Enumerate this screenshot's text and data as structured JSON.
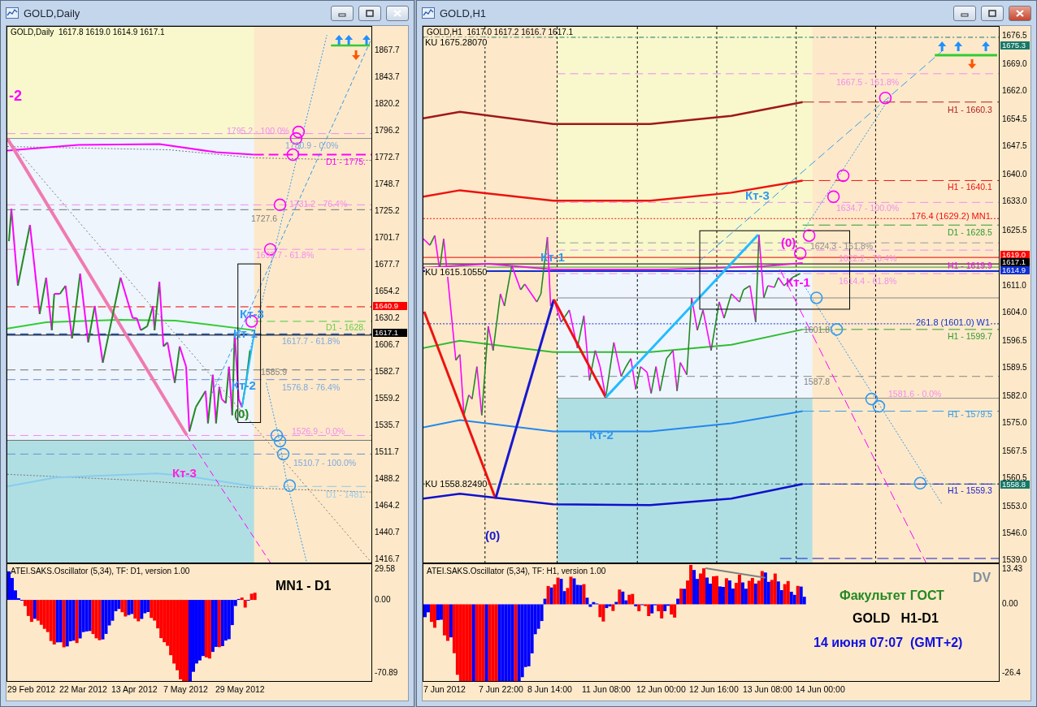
{
  "windows": [
    {
      "title": "GOLD,Daily",
      "active": false,
      "chart": {
        "header": "GOLD,Daily  1617.8 1619.0 1614.9 1617.1",
        "price_ticks": [
          "1867.7",
          "1843.7",
          "1820.2",
          "1796.2",
          "1772.7",
          "1748.7",
          "1725.2",
          "1701.7",
          "1677.7",
          "1654.2",
          "1630.2",
          "1606.7",
          "1582.7",
          "1559.2",
          "1535.7",
          "1511.7",
          "1488.2",
          "1464.2",
          "1440.7",
          "1416.7"
        ],
        "price_tags": [
          {
            "text": "1640.9",
            "color": "#ff0000"
          },
          {
            "text": "1617.1",
            "color": "#000000"
          }
        ],
        "labels": [
          {
            "text": "-2",
            "kind": "wave",
            "color": "#ff00ff"
          },
          {
            "text": "1795.2 - 100.0%",
            "kind": "level",
            "color": "#f08cf0"
          },
          {
            "text": "1780.9 - 0.0%",
            "kind": "level",
            "color": "#7fa8e0"
          },
          {
            "text": "D1 - 1775.",
            "kind": "level",
            "color": "#ff00ff"
          },
          {
            "text": "1731.2 - 76.4%",
            "kind": "level",
            "color": "#f08cf0"
          },
          {
            "text": "1727.6",
            "kind": "level",
            "color": "#808080"
          },
          {
            "text": "1692.7 - 61.8%",
            "kind": "level",
            "color": "#f08cf0"
          },
          {
            "text": "Кт-3",
            "kind": "wave",
            "color": "#3399ee"
          },
          {
            "text": "Кт-1",
            "kind": "wave",
            "color": "#3399ee"
          },
          {
            "text": "D1 - 1628.",
            "kind": "level",
            "color": "#66cc44"
          },
          {
            "text": "1617.7 - 61.8%",
            "kind": "level",
            "color": "#7fa8e0"
          },
          {
            "text": "1585.9",
            "kind": "level",
            "color": "#808080"
          },
          {
            "text": "Кт-2",
            "kind": "wave",
            "color": "#3399ee"
          },
          {
            "text": "1576.8 - 76.4%",
            "kind": "level",
            "color": "#7fa8e0"
          },
          {
            "text": "(0)",
            "kind": "wave",
            "color": "#228822"
          },
          {
            "text": "1526.9 - 0.0%",
            "kind": "level",
            "color": "#f08cf0"
          },
          {
            "text": "1510.7 - 100.0%",
            "kind": "level",
            "color": "#7fa8e0"
          },
          {
            "text": "Кт-3",
            "kind": "wave",
            "color": "#ff22dd"
          },
          {
            "text": "D1 - 1481.",
            "kind": "level",
            "color": "#99ccee"
          }
        ]
      },
      "oscillator": {
        "title": "ATEI.SAKS.Oscillator (5,34), TF: D1, version 1.00",
        "ticks": [
          "29.58",
          "0.00",
          "-70.89"
        ],
        "notes": [
          {
            "text": "MN1 - D1",
            "color": "#000000"
          }
        ]
      },
      "time_axis": [
        "29 Feb 2012",
        "22 Mar 2012",
        "13 Apr 2012",
        "7 May 2012",
        "29 May 2012"
      ]
    },
    {
      "title": "GOLD,H1",
      "active": true,
      "chart": {
        "header": "GOLD,H1  1617.0 1617.2 1616.7 1617.1",
        "price_ticks": [
          "1676.5",
          "1669.0",
          "1662.0",
          "1654.5",
          "1647.5",
          "1640.0",
          "1633.0",
          "1625.5",
          "1611.0",
          "1604.0",
          "1596.5",
          "1589.5",
          "1582.0",
          "1575.0",
          "1567.5",
          "1560.5",
          "1553.0",
          "1546.0",
          "1539.0"
        ],
        "price_tags": [
          {
            "text": "1675.3",
            "color": "#187868"
          },
          {
            "text": "1619.0",
            "color": "#ff0000"
          },
          {
            "text": "1617.1",
            "color": "#000000"
          },
          {
            "text": "1614.9",
            "color": "#1030d0"
          },
          {
            "text": "1558.8",
            "color": "#187868"
          }
        ],
        "labels": [
          {
            "text": "KU 1675.28070",
            "kind": "note",
            "color": "#000000"
          },
          {
            "text": "1667.5 - 161.8%",
            "kind": "level",
            "color": "#f08cf0"
          },
          {
            "text": "H1 - 1660.3",
            "kind": "level",
            "color": "#b02020"
          },
          {
            "text": "H1 - 1640.1",
            "kind": "level",
            "color": "#ee1111"
          },
          {
            "text": "Кт-3",
            "kind": "wave",
            "color": "#3399ee"
          },
          {
            "text": "1634.7 - 100.0%",
            "kind": "level",
            "color": "#f08cf0"
          },
          {
            "text": "176.4 (1629.2) MN1",
            "kind": "note",
            "color": "#ee1111"
          },
          {
            "text": "D1 - 1628.5",
            "kind": "level",
            "color": "#339933"
          },
          {
            "text": "(0)",
            "kind": "wave",
            "color": "#ff00ff"
          },
          {
            "text": "1624.3 - 161.8%",
            "kind": "level",
            "color": "#909090"
          },
          {
            "text": "1622.2 - 76.4%",
            "kind": "level",
            "color": "#f08cf0"
          },
          {
            "text": "H1 - 1619.9",
            "kind": "level",
            "color": "#ff00ff"
          },
          {
            "text": "Кт-1",
            "kind": "wave",
            "color": "#3399ee"
          },
          {
            "text": "KU 1615.10550",
            "kind": "note",
            "color": "#000000"
          },
          {
            "text": "Кт-1",
            "kind": "wave",
            "color": "#ff00ff"
          },
          {
            "text": "1614.4 - 61.8%",
            "kind": "level",
            "color": "#f08cf0"
          },
          {
            "text": "261.8 (1601.0) W1",
            "kind": "note",
            "color": "#1030d0"
          },
          {
            "text": "1601.8",
            "kind": "level",
            "color": "#808080"
          },
          {
            "text": "H1 - 1599.7",
            "kind": "level",
            "color": "#339933"
          },
          {
            "text": "1587.8",
            "kind": "level",
            "color": "#808080"
          },
          {
            "text": "1581.6 - 0.0%",
            "kind": "level",
            "color": "#f08cf0"
          },
          {
            "text": "H1 - 1579.5",
            "kind": "level",
            "color": "#3399ee"
          },
          {
            "text": "Кт-2",
            "kind": "wave",
            "color": "#3399ee"
          },
          {
            "text": "KU 1558.82490",
            "kind": "note",
            "color": "#000000"
          },
          {
            "text": "H1 - 1559.3",
            "kind": "level",
            "color": "#1818d0"
          },
          {
            "text": "(0)",
            "kind": "wave",
            "color": "#1818d0"
          }
        ]
      },
      "oscillator": {
        "title": "ATEI.SAKS.Oscillator (5,34), TF: H1, version 1.00",
        "ticks": [
          "13.43",
          "0.00",
          "-26.4"
        ],
        "notes": [
          {
            "text": "DV",
            "color": "#8090a0"
          },
          {
            "text": "Факультет ГОСТ",
            "color": "#228822"
          },
          {
            "text": "GOLD   H1-D1",
            "color": "#000000"
          },
          {
            "text": "14 июня 07:07  (GMT+2)",
            "color": "#1010e0"
          }
        ]
      },
      "time_axis": [
        "7 Jun 2012",
        "7 Jun 22:00",
        "8 Jun 14:00",
        "11 Jun 08:00",
        "12 Jun 00:00",
        "12 Jun 16:00",
        "13 Jun 08:00",
        "14 Jun 00:00"
      ]
    }
  ]
}
